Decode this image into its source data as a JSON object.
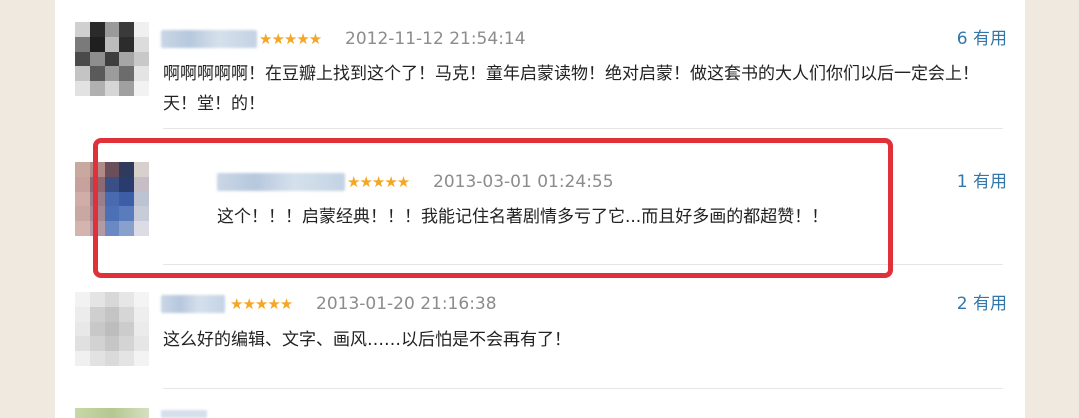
{
  "comments": [
    {
      "stars": "★★★★★",
      "date": "2012-11-12 21:54:14",
      "votes": "6 有用",
      "text": "啊啊啊啊啊！在豆瓣上找到这个了！马克！童年启蒙读物！绝对启蒙！做这套书的大人们你们以后一定会上！天！堂！的！"
    },
    {
      "stars": "★★★★★",
      "date": "2013-03-01 01:24:55",
      "votes": "1 有用",
      "text": "这个！！！启蒙经典！！！我能记住名著剧情多亏了它...而且好多画的都超赞！！"
    },
    {
      "stars": "★★★★★",
      "date": "2013-01-20 21:16:38",
      "votes": "2 有用",
      "text": "这么好的编辑、文字、画风……以后怕是不会再有了！"
    }
  ],
  "colors": {
    "star": "#f5a623",
    "vote_link": "#3377aa",
    "highlight_border": "#e0303a"
  }
}
